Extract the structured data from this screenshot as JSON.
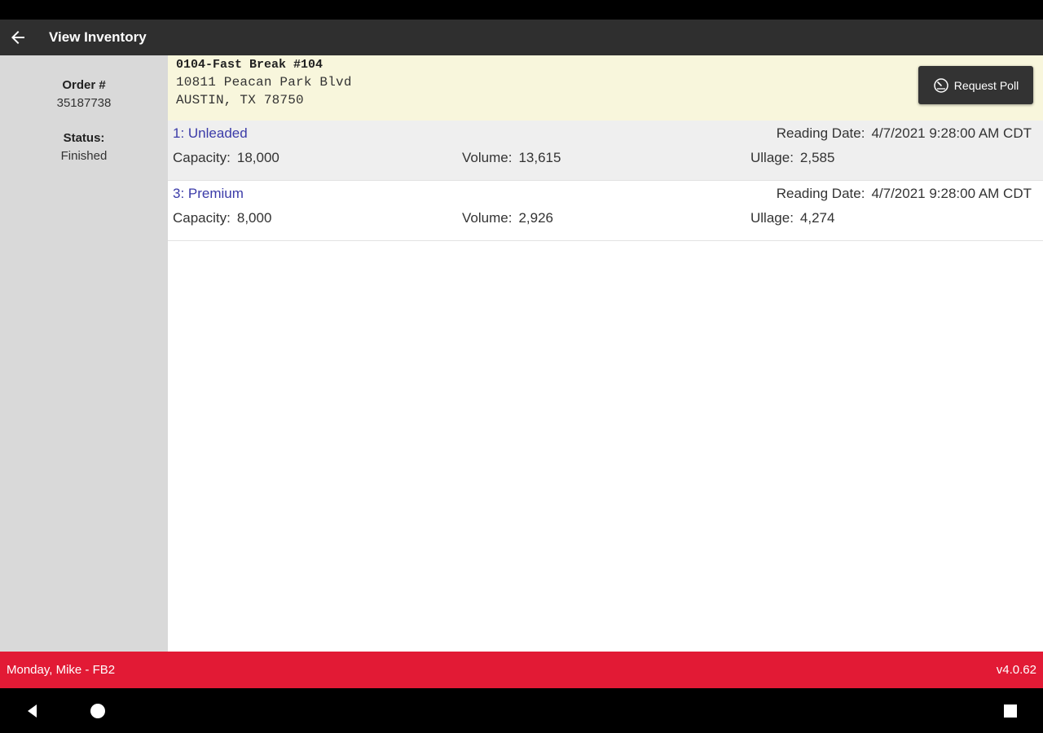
{
  "app_bar": {
    "title": "View Inventory",
    "back_icon": "arrow-left-icon"
  },
  "sidebar": {
    "order_label": "Order #",
    "order_value": "35187738",
    "status_label": "Status:",
    "status_value": "Finished"
  },
  "site": {
    "name": "0104-Fast Break #104",
    "address": "10811 Peacan Park Blvd",
    "city": "AUSTIN, TX 78750",
    "request_poll_label": "Request Poll",
    "request_poll_icon": "gauge-icon"
  },
  "tanks": [
    {
      "name": "1: Unleaded",
      "reading_label": "Reading Date:",
      "reading_value": "4/7/2021 9:28:00 AM CDT",
      "capacity_label": "Capacity:",
      "capacity_value": "18,000",
      "volume_label": "Volume:",
      "volume_value": "13,615",
      "ullage_label": "Ullage:",
      "ullage_value": "2,585"
    },
    {
      "name": "3: Premium",
      "reading_label": "Reading Date:",
      "reading_value": "4/7/2021 9:28:00 AM CDT",
      "capacity_label": "Capacity:",
      "capacity_value": "8,000",
      "volume_label": "Volume:",
      "volume_value": "2,926",
      "ullage_label": "Ullage:",
      "ullage_value": "4,274"
    }
  ],
  "footer": {
    "user": "Monday, Mike - FB2",
    "version": "v4.0.62"
  },
  "colors": {
    "app_bar": "#2f2f2f",
    "footer": "#e21a35",
    "site_header": "#f8f6dc",
    "tank_name": "#3b3ba8"
  },
  "nav": {
    "back_icon": "nav-back-icon",
    "home_icon": "nav-home-icon",
    "recents_icon": "nav-recents-icon"
  }
}
